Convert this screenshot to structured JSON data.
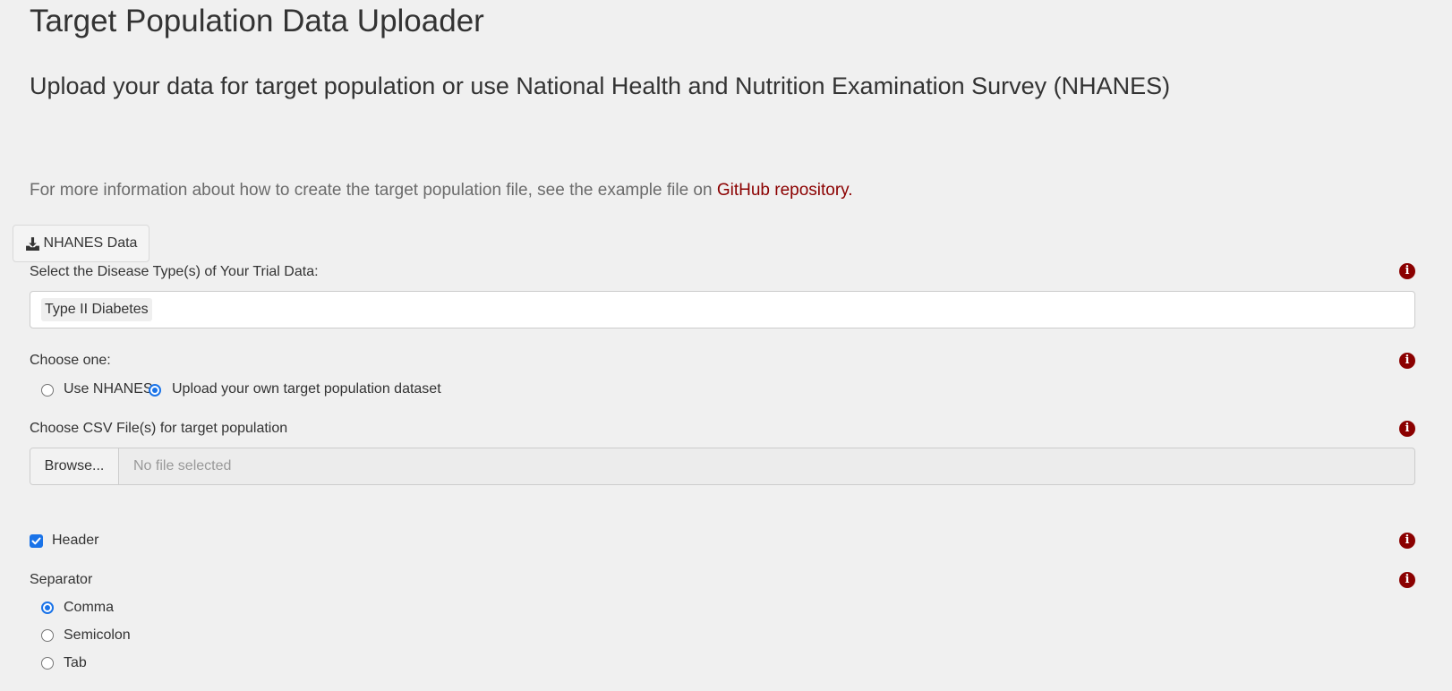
{
  "header": {
    "title": "Target Population Data Uploader",
    "subtitle": "Upload your data for target population or use National Health and Nutrition Examination Survey (NHANES)"
  },
  "info": {
    "text": "For more information about how to create the target population file, see the example file on ",
    "link_text": "GitHub repository."
  },
  "download_button": {
    "label": "NHANES Data",
    "icon": "download-icon"
  },
  "disease_select": {
    "label": "Select the Disease Type(s) of Your Trial Data:",
    "selected": "Type II Diabetes"
  },
  "choose_one": {
    "label": "Choose one:",
    "options": [
      {
        "label": "Use NHANES",
        "checked": false
      },
      {
        "label": "Upload your own target population dataset",
        "checked": true
      }
    ]
  },
  "file_upload": {
    "label": "Choose CSV File(s) for target population",
    "browse_label": "Browse...",
    "placeholder": "No file selected"
  },
  "header_checkbox": {
    "label": "Header",
    "checked": true
  },
  "separator": {
    "label": "Separator",
    "options": [
      {
        "label": "Comma",
        "checked": true
      },
      {
        "label": "Semicolon",
        "checked": false
      },
      {
        "label": "Tab",
        "checked": false
      }
    ]
  },
  "colors": {
    "accent": "#8b0000",
    "control": "#1a73e8",
    "background": "#f0f0f0"
  }
}
